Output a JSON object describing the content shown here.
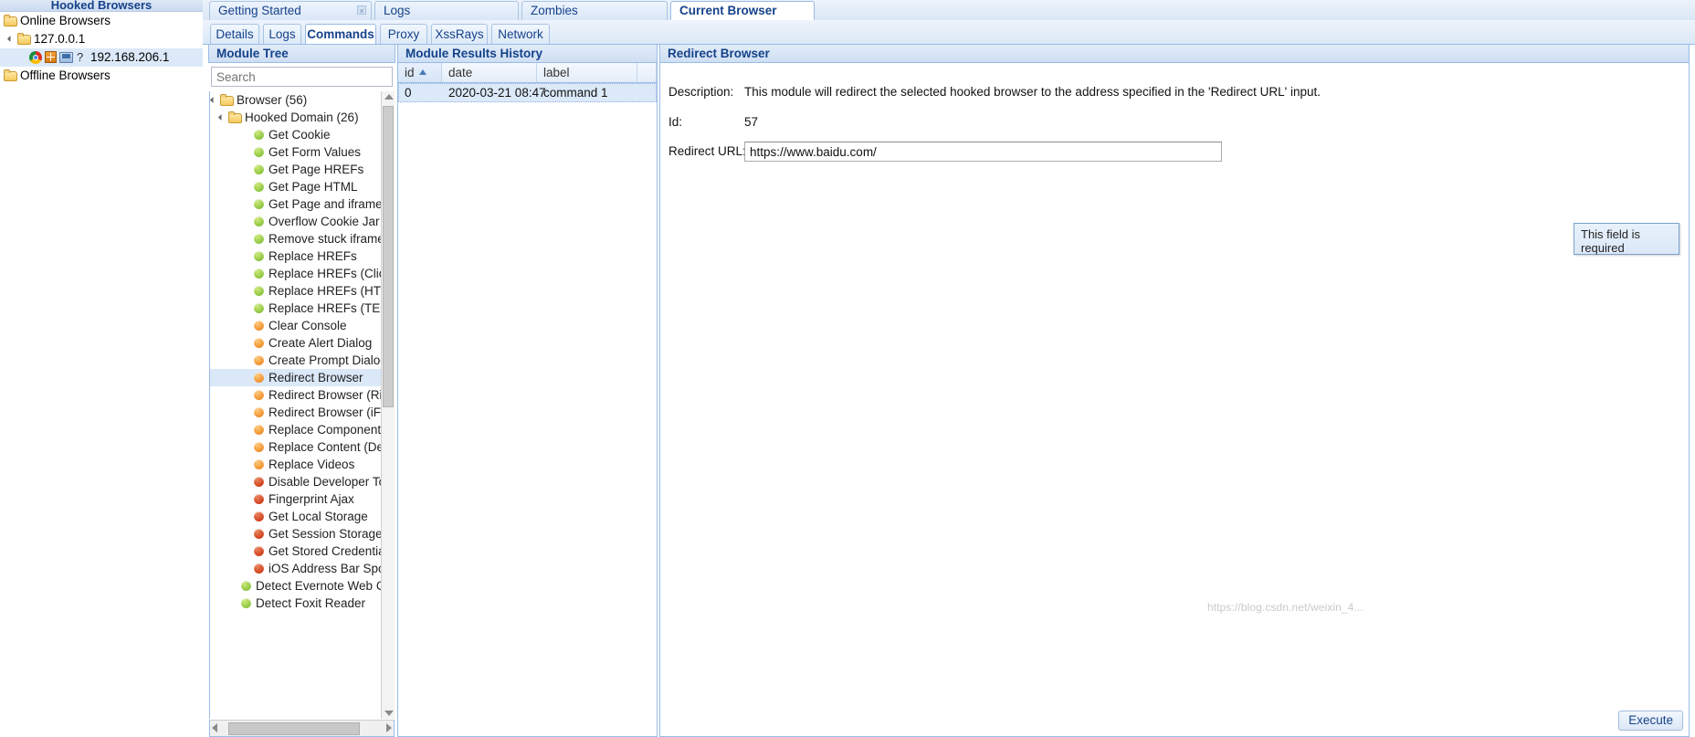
{
  "left_panel": {
    "title": "Hooked Browsers",
    "nodes": [
      {
        "label": "Online Browsers",
        "type": "folder",
        "indent": 0,
        "expander": false,
        "selected": false
      },
      {
        "label": "127.0.0.1",
        "type": "folder",
        "indent": 1,
        "expander": true,
        "selected": false
      },
      {
        "label": "192.168.206.1",
        "type": "browser",
        "indent": 2,
        "expander": false,
        "selected": true
      },
      {
        "label": "Offline Browsers",
        "type": "folder",
        "indent": 0,
        "expander": false,
        "selected": false
      }
    ]
  },
  "top_tabs": [
    {
      "label": "Getting Started",
      "active": false,
      "closable": true
    },
    {
      "label": "Logs",
      "active": false,
      "closable": false
    },
    {
      "label": "Zombies",
      "active": false,
      "closable": false
    },
    {
      "label": "Current Browser",
      "active": true,
      "closable": false
    }
  ],
  "sub_tabs": [
    {
      "label": "Details",
      "active": false
    },
    {
      "label": "Logs",
      "active": false
    },
    {
      "label": "Commands",
      "active": true
    },
    {
      "label": "Proxy",
      "active": false
    },
    {
      "label": "XssRays",
      "active": false
    },
    {
      "label": "Network",
      "active": false
    }
  ],
  "module_tree": {
    "header": "Module Tree",
    "search_placeholder": "Search",
    "search_value": "",
    "items": [
      {
        "label": "Browser (56)",
        "kind": "folder",
        "indent": 0,
        "expander": true,
        "selected": false
      },
      {
        "label": "Hooked Domain (26)",
        "kind": "folder",
        "indent": 1,
        "expander": true,
        "selected": false
      },
      {
        "label": "Get Cookie",
        "kind": "green",
        "indent": 3,
        "expander": false,
        "selected": false
      },
      {
        "label": "Get Form Values",
        "kind": "green",
        "indent": 3,
        "expander": false,
        "selected": false
      },
      {
        "label": "Get Page HREFs",
        "kind": "green",
        "indent": 3,
        "expander": false,
        "selected": false
      },
      {
        "label": "Get Page HTML",
        "kind": "green",
        "indent": 3,
        "expander": false,
        "selected": false
      },
      {
        "label": "Get Page and iframe",
        "kind": "green",
        "indent": 3,
        "expander": false,
        "selected": false
      },
      {
        "label": "Overflow Cookie Jar",
        "kind": "green",
        "indent": 3,
        "expander": false,
        "selected": false
      },
      {
        "label": "Remove stuck iframe",
        "kind": "green",
        "indent": 3,
        "expander": false,
        "selected": false
      },
      {
        "label": "Replace HREFs",
        "kind": "green",
        "indent": 3,
        "expander": false,
        "selected": false
      },
      {
        "label": "Replace HREFs (Click",
        "kind": "green",
        "indent": 3,
        "expander": false,
        "selected": false
      },
      {
        "label": "Replace HREFs (HTT",
        "kind": "green",
        "indent": 3,
        "expander": false,
        "selected": false
      },
      {
        "label": "Replace HREFs (TEL",
        "kind": "green",
        "indent": 3,
        "expander": false,
        "selected": false
      },
      {
        "label": "Clear Console",
        "kind": "orange",
        "indent": 3,
        "expander": false,
        "selected": false
      },
      {
        "label": "Create Alert Dialog",
        "kind": "orange",
        "indent": 3,
        "expander": false,
        "selected": false
      },
      {
        "label": "Create Prompt Dialog",
        "kind": "orange",
        "indent": 3,
        "expander": false,
        "selected": false
      },
      {
        "label": "Redirect Browser",
        "kind": "orange",
        "indent": 3,
        "expander": false,
        "selected": true
      },
      {
        "label": "Redirect Browser (Ri",
        "kind": "orange",
        "indent": 3,
        "expander": false,
        "selected": false
      },
      {
        "label": "Redirect Browser (iFr",
        "kind": "orange",
        "indent": 3,
        "expander": false,
        "selected": false
      },
      {
        "label": "Replace Component",
        "kind": "orange",
        "indent": 3,
        "expander": false,
        "selected": false
      },
      {
        "label": "Replace Content (De",
        "kind": "orange",
        "indent": 3,
        "expander": false,
        "selected": false
      },
      {
        "label": "Replace Videos",
        "kind": "orange",
        "indent": 3,
        "expander": false,
        "selected": false
      },
      {
        "label": "Disable Developer To",
        "kind": "red",
        "indent": 3,
        "expander": false,
        "selected": false
      },
      {
        "label": "Fingerprint Ajax",
        "kind": "red",
        "indent": 3,
        "expander": false,
        "selected": false
      },
      {
        "label": "Get Local Storage",
        "kind": "red",
        "indent": 3,
        "expander": false,
        "selected": false
      },
      {
        "label": "Get Session Storage",
        "kind": "red",
        "indent": 3,
        "expander": false,
        "selected": false
      },
      {
        "label": "Get Stored Credentia",
        "kind": "red",
        "indent": 3,
        "expander": false,
        "selected": false
      },
      {
        "label": "iOS Address Bar Spo",
        "kind": "red",
        "indent": 3,
        "expander": false,
        "selected": false
      },
      {
        "label": "Detect Evernote Web Cli",
        "kind": "green",
        "indent": 2,
        "expander": false,
        "selected": false
      },
      {
        "label": "Detect Foxit Reader",
        "kind": "green",
        "indent": 2,
        "expander": false,
        "selected": false
      }
    ]
  },
  "results_history": {
    "header": "Module Results History",
    "columns": [
      {
        "label": "id",
        "sorted": true
      },
      {
        "label": "date",
        "sorted": false
      },
      {
        "label": "label",
        "sorted": false
      }
    ],
    "rows": [
      {
        "id": "0",
        "date": "2020-03-21 08:47",
        "label": "command 1"
      }
    ]
  },
  "detail": {
    "header": "Redirect Browser",
    "description_label": "Description:",
    "description_value": "This module will redirect the selected hooked browser to the address specified in the 'Redirect URL' input.",
    "id_label": "Id:",
    "id_value": "57",
    "url_label": "Redirect URL:",
    "url_value": "https://www.baidu.com/",
    "url_placeholder": "",
    "tooltip_text": "This field is required",
    "execute_label": "Execute"
  },
  "watermark": "https://blog.csdn.net/weixin_4..."
}
